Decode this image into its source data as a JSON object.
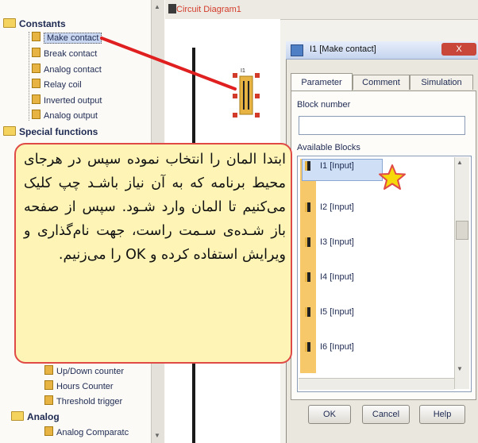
{
  "tree": {
    "constants": "Constants",
    "items": [
      "Make contact",
      "Break contact",
      "Analog contact",
      "Relay coil",
      "Inverted output",
      "Analog output"
    ],
    "special": "Special functions",
    "lower_items": [
      "Up/Down counter",
      "Hours Counter",
      "Threshold trigger"
    ],
    "analog": "Analog",
    "analog_item": "Analog Comparatc"
  },
  "canvas": {
    "tab_label": "Circuit Diagram1",
    "block_label": "I1"
  },
  "dialog": {
    "title": "I1 [Make contact]",
    "close": "X",
    "tabs": [
      "Parameter",
      "Comment",
      "Simulation"
    ],
    "block_number_label": "Block number",
    "available_label": "Available Blocks",
    "blocks": [
      "I1 [Input]",
      "I2 [Input]",
      "I3 [Input]",
      "I4 [Input]",
      "I5 [Input]",
      "I6 [Input]"
    ],
    "buttons": {
      "ok": "OK",
      "cancel": "Cancel",
      "help": "Help"
    }
  },
  "callout": {
    "text": "ابتدا المان را انتخاب نموده سپس در هرجای محیط برنامه که به آن نیاز باشـد چپ کلیک می‌کنیم تا المان وارد شـود. سپس از صفحه باز شـده‌ی سـمت راست، جهت نام‌گذاری و ویرایش استفاده کرده و OK را می‌زنیم."
  },
  "colors": {
    "callout_border": "#e04a46",
    "callout_bg": "#fdf4b6",
    "star": "#f5d90a",
    "pointer_line": "#e02020"
  }
}
